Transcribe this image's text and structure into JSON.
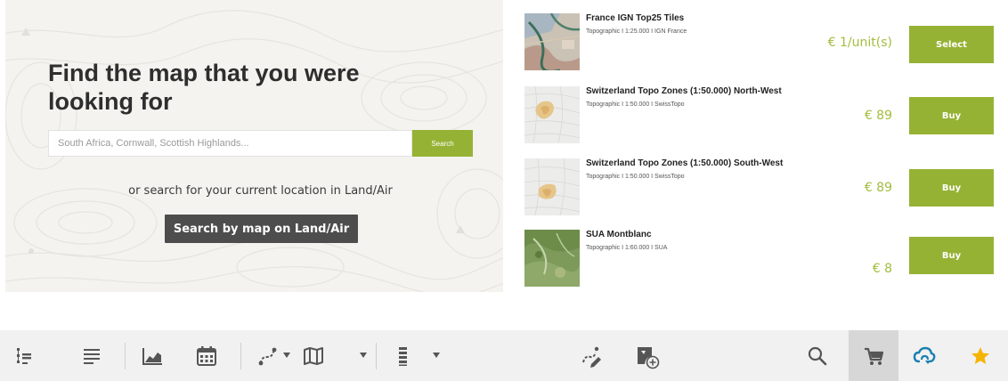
{
  "search_panel": {
    "headline": "Find the map that you were looking for",
    "search_placeholder": "South Africa, Cornwall, Scottish Highlands...",
    "search_button": "Search",
    "alt_text": "or search for your current location in Land/Air",
    "landair_button": "Search by map on Land/Air"
  },
  "products": [
    {
      "title": "France IGN Top25 Tiles",
      "meta": "Topographic  I  1:25.000  I  IGN France",
      "price": "€ 1/unit(s)",
      "button": "Select"
    },
    {
      "title": "Switzerland Topo Zones (1:50.000) North-West",
      "meta": "Topographic  I  1:50.000  I  SwissTopo",
      "price": "€ 89",
      "button": "Buy"
    },
    {
      "title": "Switzerland Topo Zones (1:50.000) South-West",
      "meta": "Topographic  I  1:50.000  I  SwissTopo",
      "price": "€ 89",
      "button": "Buy"
    },
    {
      "title": "SUA Montblanc",
      "meta": "Topographic  I  1:60.000  I  SUA",
      "price": "€ 8",
      "button": "Buy"
    }
  ],
  "toolbar": {
    "icons": [
      "tree-list-icon",
      "text-lines-icon",
      "area-chart-icon",
      "calendar-icon",
      "route-icon",
      "map-icon",
      "stack-list-icon",
      "route-edit-icon",
      "add-map-icon",
      "search-icon",
      "cart-icon",
      "cloud-sync-icon",
      "star-icon"
    ],
    "active": "cart-icon"
  },
  "colors": {
    "accent_green": "#96b234",
    "price_green": "#a2bd3e",
    "dark_button": "#4d4d4d",
    "toolbar_bg": "#f1f1f1",
    "sync_blue": "#1a7fb0",
    "star_yellow": "#f5b400"
  }
}
